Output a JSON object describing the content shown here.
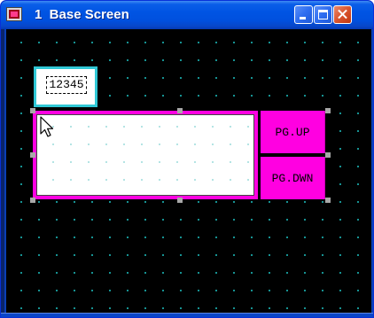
{
  "window": {
    "title": "1  Base Screen",
    "controls": {
      "minimize": "minimize-icon",
      "maximize": "maximize-icon",
      "close": "close-icon"
    },
    "colors": {
      "titlebar": "#0054e3",
      "canvas": "#000000",
      "grid_dot": "#1aa8a8",
      "close_button": "#d9542e"
    }
  },
  "canvas": {
    "numeric_display": {
      "value": "12345",
      "border_color": "#30c8d6"
    },
    "list_box": {
      "frame_color": "#ff00e1",
      "fill_color": "#ffffff"
    },
    "buttons": {
      "page_up": "PG.UP",
      "page_down": "PG.DWN",
      "color": "#ff00e1"
    },
    "selection_handle_color": "#a8a8a8",
    "cursor": "arrow-cursor-icon"
  }
}
